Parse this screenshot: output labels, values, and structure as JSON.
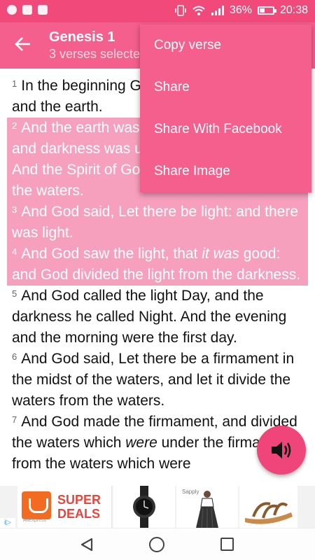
{
  "status_bar": {
    "battery": "36%",
    "time": "20:38",
    "icons": [
      "whatsapp-icon",
      "app-icon",
      "mail-icon",
      "vibrate-icon",
      "wifi-icon",
      "signal-icon",
      "battery-icon"
    ]
  },
  "app_bar": {
    "title": "Genesis 1",
    "subtitle": "3 verses selected",
    "back_icon": "arrow-left-icon"
  },
  "verses": [
    {
      "num": "1",
      "text": "In the beginning God created the heaven and the earth.",
      "selected": false
    },
    {
      "num": "2",
      "text": "And the earth was without form, and void; and darkness was upon the face of the deep. And the Spirit of God moved upon the face of the waters.",
      "selected": true
    },
    {
      "num": "3",
      "text": "And God said, Let there be light: and there was light.",
      "selected": true
    },
    {
      "num": "4",
      "text_before": "And God saw the light, that ",
      "text_italic": "it was",
      "text_after": " good: and God divided the light from the darkness.",
      "selected": true
    },
    {
      "num": "5",
      "text": "And God called the light Day, and the darkness he called Night. And the evening and the morning were the first day.",
      "selected": false
    },
    {
      "num": "6",
      "text": "And God said, Let there be a firmament in the midst of the waters, and let it divide the waters from the waters.",
      "selected": false
    },
    {
      "num": "7",
      "text_before": "And God made the firmament, and divided the waters which ",
      "text_italic": "were",
      "text_after": " under the firmament from the waters which were",
      "selected": false
    }
  ],
  "menu": {
    "items": [
      "Copy verse",
      "Share",
      "Share With Facebook",
      "Share Image"
    ]
  },
  "fab": {
    "icon": "speaker-icon"
  },
  "ad": {
    "super": "SUPER",
    "deals": "DEALS",
    "brand": "AliExpress",
    "dress_brand": "Sapply",
    "badge": "i▷"
  },
  "colors": {
    "status_bar": "#f2497b",
    "app_bar": "#f45f8d",
    "selection": "#f7a0be",
    "fab": "#f0457a"
  }
}
